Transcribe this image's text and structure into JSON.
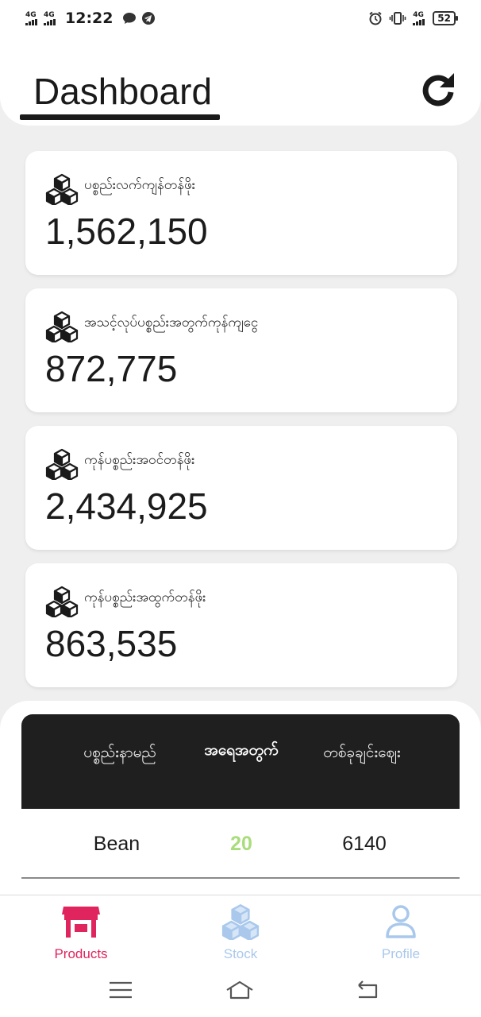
{
  "status_bar": {
    "signal1": "4G",
    "signal2": "4G",
    "time": "12:22",
    "network_right": "4G",
    "battery": "52"
  },
  "header": {
    "title": "Dashboard"
  },
  "cards": [
    {
      "label": "ပစ္စည်းလက်ကျန်တန်ဖိုး",
      "value": "1,562,150",
      "icon": "cubes-icon"
    },
    {
      "label": "အသင့်လုပ်ပစ္စည်းအတွက်ကုန်ကျငွေ",
      "value": "872,775",
      "icon": "cubes-icon"
    },
    {
      "label": "ကုန်ပစ္စည်းအဝင်တန်ဖိုး",
      "value": "2,434,925",
      "icon": "cubes-icon"
    },
    {
      "label": "ကုန်ပစ္စည်းအထွက်တန်ဖိုး",
      "value": "863,535",
      "icon": "cubes-icon"
    }
  ],
  "table": {
    "headers": [
      "ပစ္စည်းနာမည်",
      "အရေအတွက်",
      "တစ်ခုချင်းဈေး"
    ],
    "rows": [
      [
        "Bean",
        "20",
        "6140"
      ]
    ]
  },
  "bottom_nav": {
    "items": [
      {
        "label": "Products",
        "icon": "store-icon",
        "active": true
      },
      {
        "label": "Stock",
        "icon": "cubes-icon",
        "active": false
      },
      {
        "label": "Profile",
        "icon": "user-icon",
        "active": false
      }
    ]
  },
  "colors": {
    "active": "#e0245e",
    "inactive": "#a9c8ec",
    "qty": "#a9dd7b",
    "header_bg": "#1f1f1f"
  }
}
